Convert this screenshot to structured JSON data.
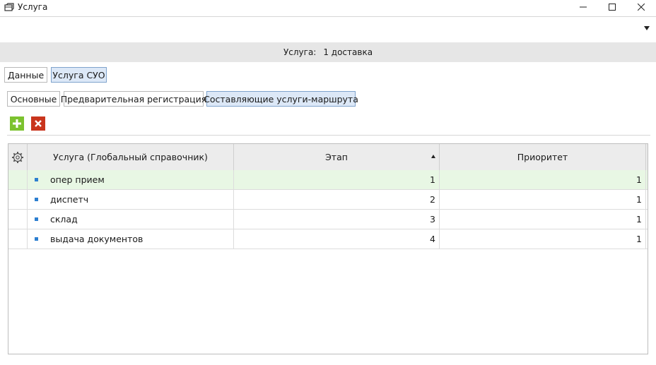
{
  "window": {
    "title": "Услуга",
    "controls": [
      "minimize-icon",
      "maximize-icon",
      "close-icon"
    ]
  },
  "header": {
    "label": "Услуга:",
    "value": "1 доставка"
  },
  "top_tabs": [
    {
      "label": "Данные",
      "active": false
    },
    {
      "label": "Услуга СУО",
      "active": true
    }
  ],
  "sub_tabs": [
    {
      "label": "Основные",
      "active": false
    },
    {
      "label": "Предварительная регистрация",
      "active": false
    },
    {
      "label": "Составляющие услуги-маршрута",
      "active": true
    }
  ],
  "toolbar": {
    "add_icon": "plus-icon",
    "delete_icon": "x-icon",
    "add_color": "#7cc22f",
    "delete_color": "#c9351d"
  },
  "grid": {
    "columns": [
      {
        "label": "Услуга (Глобальный справочник)"
      },
      {
        "label": "Этап",
        "sorted": "ascending"
      },
      {
        "label": "Приоритет"
      }
    ],
    "rows": [
      {
        "service": "опер прием",
        "stage": "1",
        "priority": "1",
        "selected": true
      },
      {
        "service": "диспетч",
        "stage": "2",
        "priority": "1"
      },
      {
        "service": "склад",
        "stage": "3",
        "priority": "1"
      },
      {
        "service": "выдача документов",
        "stage": "4",
        "priority": "1"
      }
    ],
    "selected_row_color": "#e8f7e4",
    "bullet_color": "#2d7fd0"
  }
}
